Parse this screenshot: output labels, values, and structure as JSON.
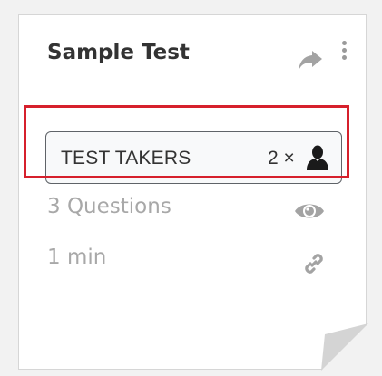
{
  "card": {
    "title": "Sample Test",
    "test_takers": {
      "label": "TEST TAKERS",
      "count": "2 ×",
      "icon": "person-icon"
    },
    "questions": "3 Questions",
    "duration": "1 min",
    "icons": {
      "share": "share-icon",
      "more": "more-vertical-icon",
      "preview": "eye-icon",
      "link": "link-icon"
    }
  },
  "colors": {
    "highlight": "#d6202c",
    "title": "#333333",
    "muted": "#a8a8a8",
    "icon": "#9a9a9a"
  }
}
